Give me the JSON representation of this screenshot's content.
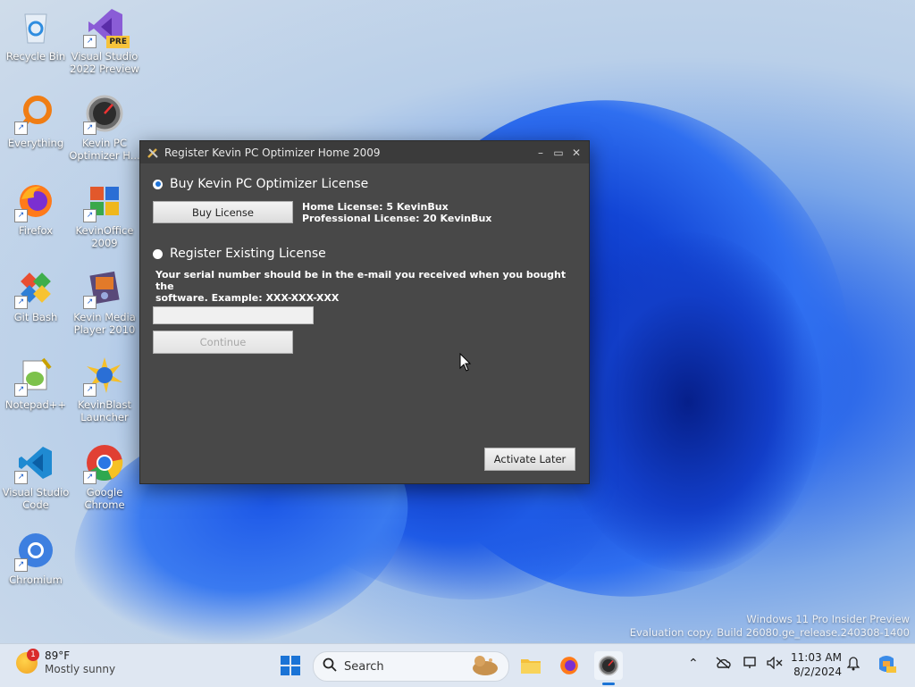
{
  "desktop": {
    "icons": [
      {
        "label": "Recycle Bin"
      },
      {
        "label": "Visual Studio 2022 Preview",
        "badge": "PRE"
      },
      {
        "label": "Everything"
      },
      {
        "label": "Kevin PC Optimizer H..."
      },
      {
        "label": "Firefox"
      },
      {
        "label": "KevinOffice 2009"
      },
      {
        "label": "Git Bash"
      },
      {
        "label": "Kevin Media Player 2010"
      },
      {
        "label": "Notepad++"
      },
      {
        "label": "KevinBlast Launcher"
      },
      {
        "label": "Visual Studio Code"
      },
      {
        "label": "Google Chrome"
      },
      {
        "label": "Chromium"
      }
    ]
  },
  "dialog": {
    "title": "Register Kevin PC Optimizer Home 2009",
    "buy_option_label": "Buy Kevin PC Optimizer License",
    "buy_button": "Buy License",
    "home_license": "Home License: 5 KevinBux",
    "pro_license": "Professional License: 20 KevinBux",
    "register_option_label": "Register Existing License",
    "serial_info_line1": "Your serial number should be in the e-mail you received when you bought the",
    "serial_info_line2": "software. Example: XXX-XXX-XXX",
    "serial_value": "",
    "continue_button": "Continue",
    "activate_later_button": "Activate Later",
    "selected_option": "buy"
  },
  "watermark": {
    "line1": "Windows 11 Pro Insider Preview",
    "line2": "Evaluation copy. Build 26080.ge_release.240308-1400"
  },
  "taskbar": {
    "weather_temp": "89°F",
    "weather_desc": "Mostly sunny",
    "weather_badge": "1",
    "search_placeholder": "Search",
    "time": "11:03 AM",
    "date": "8/2/2024"
  },
  "colors": {
    "dialog_bg": "#484848",
    "titlebar_bg": "#3b3b3b",
    "taskbar_bg": "#dfe7f2",
    "radio_accent": "#1e73d8"
  }
}
